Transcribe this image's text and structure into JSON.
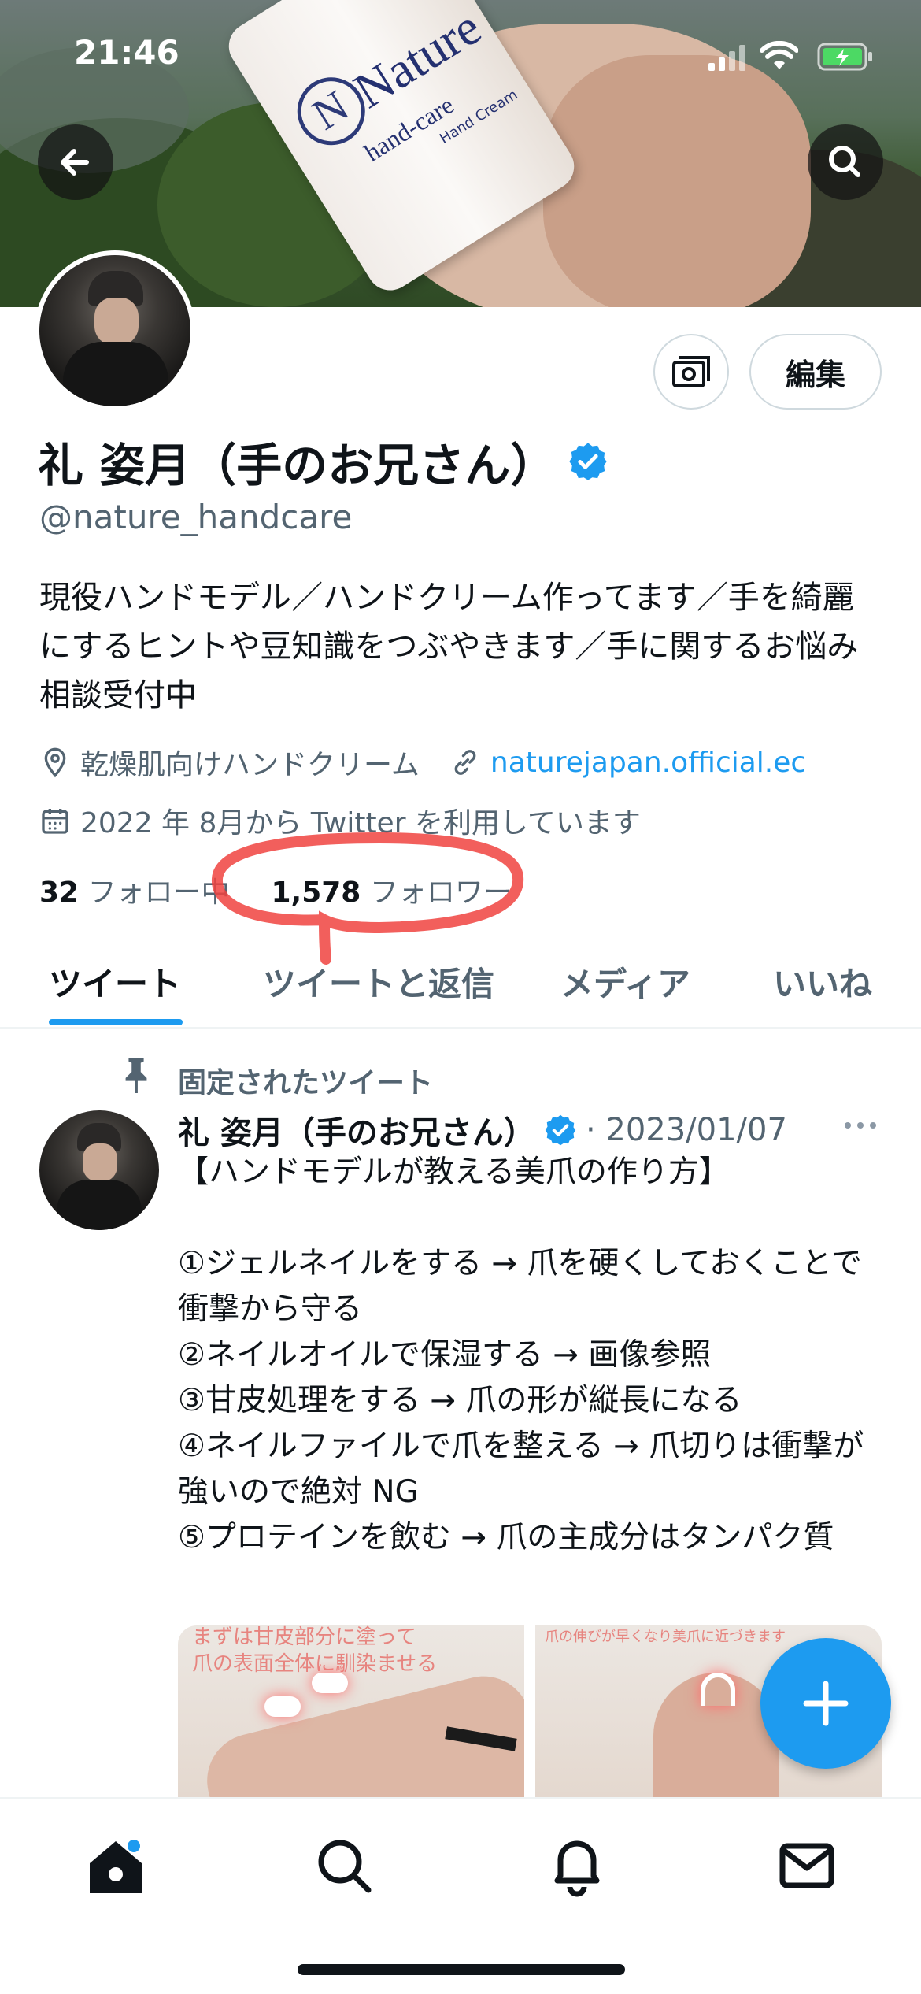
{
  "status_bar": {
    "time": "21:46"
  },
  "banner": {
    "product_brand": "Nature",
    "product_subtext": "hand-care",
    "product_small_text": "Hand Cream"
  },
  "profile": {
    "edit_label": "編集",
    "name": "礼 姿月（手のお兄さん）",
    "handle": "@nature_handcare",
    "bio": "現役ハンドモデル／ハンドクリーム作ってます／手を綺麗にするヒントや豆知識をつぶやきます／手に関するお悩み相談受付中",
    "location": "乾燥肌向けハンドクリーム",
    "website": "naturejapan.official.ec",
    "joined": "2022 年 8月から Twitter を利用しています",
    "following_count": "32",
    "following_label": "フォロー中",
    "followers_count": "1,578",
    "followers_label": "フォロワー"
  },
  "tabs": [
    "ツイート",
    "ツイートと返信",
    "メディア",
    "いいね"
  ],
  "pinned_tweet": {
    "pinned_label": "固定されたツイート",
    "author": "礼 姿月（手のお兄さん）",
    "date": "· 2023/01/07",
    "body": "【ハンドモデルが教える美爪の作り方】\n\n①ジェルネイルをする → 爪を硬くしておくことで衝撃から守る\n②ネイルオイルで保湿する → 画像参照\n③甘皮処理をする → 爪の形が縦長になる\n④ネイルファイルで爪を整える → 爪切りは衝撃が強いので絶対 NG\n⑤プロテインを飲む → 爪の主成分はタンパク質",
    "image_left_caption_1": "まずは甘皮部分に塗って",
    "image_left_caption_2": "爪の表面全体に馴染ませる",
    "image_right_caption": "爪の伸びが早くなり美爪に近づきます"
  },
  "colors": {
    "accent": "#1d9bf0",
    "annotation_red": "#f0433f",
    "secondary_text": "#536471"
  },
  "icons": [
    "back-arrow-icon",
    "search-icon",
    "tip-jar-icon",
    "verified-badge-icon",
    "location-pin-icon",
    "link-icon",
    "calendar-icon",
    "pin-icon",
    "more-icon",
    "compose-plus-icon",
    "home-icon",
    "search-icon",
    "bell-icon",
    "mail-icon"
  ]
}
